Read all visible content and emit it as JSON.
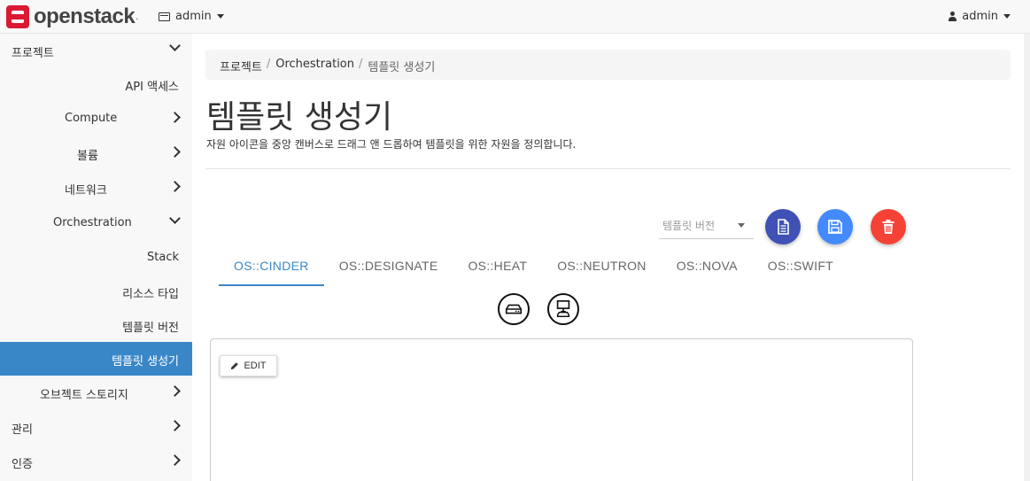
{
  "brand": {
    "name": "openstack",
    "trademark": "."
  },
  "navbar": {
    "project_label": "admin",
    "user_label": "admin"
  },
  "sidebar": {
    "items": [
      {
        "label": "프로젝트"
      },
      {
        "label": "API 액세스"
      },
      {
        "label": "Compute"
      },
      {
        "label": "볼륨"
      },
      {
        "label": "네트워크"
      },
      {
        "label": "Orchestration"
      },
      {
        "label": "Stack"
      },
      {
        "label": "리소스 타입"
      },
      {
        "label": "템플릿 버전"
      },
      {
        "label": "템플릿 생성기"
      },
      {
        "label": "오브젝트 스토리지"
      },
      {
        "label": "관리"
      },
      {
        "label": "인증"
      }
    ]
  },
  "breadcrumb": {
    "items": [
      "프로젝트",
      "Orchestration",
      "템플릿 생성기"
    ],
    "separator": "/"
  },
  "page": {
    "title": "템플릿 생성기",
    "description": "자원 아이콘을 중앙 캔버스로 드래그 앤 드롭하여 템플릿을 위한 자원을 정의합니다."
  },
  "toolbar": {
    "version_placeholder": "템플릿 버전"
  },
  "tabs": [
    {
      "label": "OS::CINDER"
    },
    {
      "label": "OS::DESIGNATE"
    },
    {
      "label": "OS::HEAT"
    },
    {
      "label": "OS::NEUTRON"
    },
    {
      "label": "OS::NOVA"
    },
    {
      "label": "OS::SWIFT"
    }
  ],
  "canvas": {
    "edit_label": "EDIT"
  },
  "colors": {
    "active": "#3a87c8",
    "doc_button": "#3f51b5",
    "save_button": "#448aff",
    "delete_button": "#f44336",
    "brand": "#da1a32"
  },
  "icons": [
    "document-icon",
    "save-icon",
    "trash-icon",
    "volume-icon",
    "volume-attachment-icon",
    "pencil-icon"
  ]
}
